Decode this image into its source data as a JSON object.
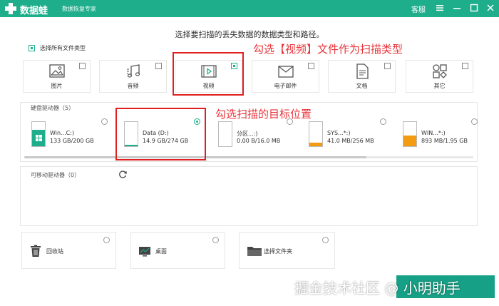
{
  "app": {
    "name": "数据蛙",
    "subtitle": "数据恢复专家",
    "service": "客服"
  },
  "heading": "选择要扫描的丢失数据的数据类型和路径。",
  "select_all": "选择所有文件类型",
  "annotations": {
    "video": "勾选【视频】文件作为扫描类型",
    "target": "勾选扫描的目标位置"
  },
  "file_types": [
    {
      "label": "图片",
      "icon": "image-icon",
      "checked": false
    },
    {
      "label": "音频",
      "icon": "music-icon",
      "checked": false
    },
    {
      "label": "视频",
      "icon": "video-icon",
      "checked": true
    },
    {
      "label": "电子邮件",
      "icon": "mail-icon",
      "checked": false
    },
    {
      "label": "文档",
      "icon": "document-icon",
      "checked": false
    },
    {
      "label": "其它",
      "icon": "other-icon",
      "checked": false
    }
  ],
  "hard_drives": {
    "title": "硬盘驱动器（5）",
    "items": [
      {
        "name": "Win...C:)",
        "size": "133 GB/200 GB",
        "used_fraction": 0.665,
        "color": "#1fae8c",
        "selected": false
      },
      {
        "name": "Data (D:)",
        "size": "14.9 GB/274 GB",
        "used_fraction": 0.054,
        "color": "#1fae8c",
        "selected": true
      },
      {
        "name": "分区...:)",
        "size": "0.00  B/16.0 MB",
        "used_fraction": 0.0,
        "color": "#1fae8c",
        "selected": false
      },
      {
        "name": "SYS...*:)",
        "size": "41.0 MB/256 MB",
        "used_fraction": 0.16,
        "color": "#f39c12",
        "selected": false
      },
      {
        "name": "WIN...*:)",
        "size": "893 MB/1.95 GB",
        "used_fraction": 0.45,
        "color": "#f39c12",
        "selected": false
      }
    ]
  },
  "removable": {
    "title": "可移动驱动器（0）"
  },
  "locations": [
    {
      "label": "回收站",
      "icon": "recycle-bin-icon"
    },
    {
      "label": "桌面",
      "icon": "desktop-icon"
    },
    {
      "label": "选择文件夹",
      "icon": "folder-icon"
    }
  ],
  "watermark": "掘金技术社区 @ 小明助手",
  "colors": {
    "brand": "#1fae8c",
    "annotation": "#e02020"
  }
}
